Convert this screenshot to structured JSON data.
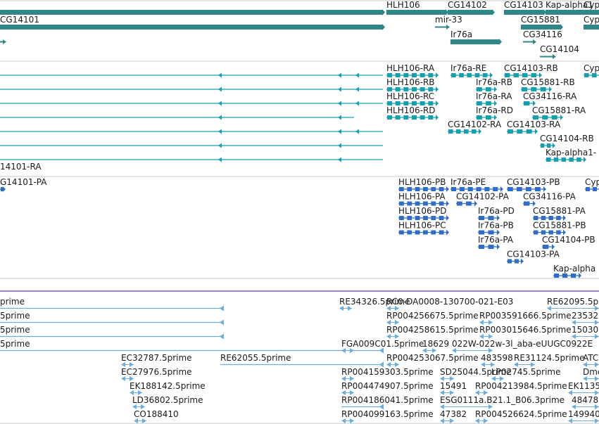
{
  "view": {
    "bp_start": 0,
    "bp_end": 851
  },
  "colors": {
    "gene": "#2f8787",
    "transcript": "#15a0b2",
    "protein": "#2f6dc8",
    "est": "#6aaee0",
    "divider": "#c8c8c8",
    "separator": "#7e57c2",
    "text": "#1a1a1a"
  },
  "tracks": {
    "genes": {
      "rows": [
        {
          "features": [
            {
              "name": "",
              "start": 0,
              "end": 544,
              "type": "bar"
            },
            {
              "name": "HLH106",
              "start": 549,
              "end": 634,
              "type": "bar"
            },
            {
              "name": "CG14102",
              "start": 636,
              "end": 700,
              "type": "bar"
            },
            {
              "name": "CG14103",
              "start": 716,
              "end": 773,
              "type": "bar"
            },
            {
              "name": "Kap-alpha1",
              "start": 775,
              "end": 829,
              "type": "bar"
            },
            {
              "name": "Cyp",
              "start": 829,
              "end": 851,
              "type": "bar"
            }
          ]
        },
        {
          "features": [
            {
              "name": "CG14101",
              "start": 0,
              "end": 544,
              "type": "bar"
            },
            {
              "name": "mir-33",
              "start": 618,
              "end": 634,
              "type": "arrow"
            },
            {
              "name": "CG15881",
              "start": 740,
              "end": 797,
              "type": "bar"
            },
            {
              "name": "Cyp",
              "start": 829,
              "end": 851,
              "type": "bar"
            }
          ]
        },
        {
          "features": [
            {
              "name": "",
              "start": 0,
              "end": 4,
              "type": "arrow"
            },
            {
              "name": "Ir76a",
              "start": 640,
              "end": 710,
              "type": "bar"
            },
            {
              "name": "CG34116",
              "start": 743,
              "end": 757,
              "type": "arrow"
            }
          ]
        },
        {
          "features": [
            {
              "name": "CG14104",
              "start": 767,
              "end": 785,
              "type": "arrow"
            }
          ]
        }
      ]
    },
    "transcripts": {
      "rows": [
        {
          "features": [
            {
              "name": "",
              "start": 0,
              "end": 544,
              "type": "line",
              "marks": [
                315,
                485,
                510
              ]
            },
            {
              "name": "HLH106-RA",
              "start": 549,
              "end": 619,
              "type": "exons"
            },
            {
              "name": "Ir76a-RE",
              "start": 640,
              "end": 696,
              "type": "exons"
            },
            {
              "name": "CG14103-RB",
              "start": 716,
              "end": 766,
              "type": "exons"
            },
            {
              "name": "Cyp",
              "start": 829,
              "end": 851,
              "type": "exons"
            }
          ]
        },
        {
          "features": [
            {
              "name": "",
              "start": 0,
              "end": 544,
              "type": "line",
              "marks": [
                315,
                485,
                510
              ]
            },
            {
              "name": "HLH106-RB",
              "start": 549,
              "end": 619,
              "type": "exons"
            },
            {
              "name": "Ir76a-RB",
              "start": 676,
              "end": 702,
              "type": "exons"
            },
            {
              "name": "CG15881-RB",
              "start": 740,
              "end": 780,
              "type": "exons"
            }
          ]
        },
        {
          "features": [
            {
              "name": "",
              "start": 0,
              "end": 544,
              "type": "line",
              "marks": [
                315,
                485,
                510
              ]
            },
            {
              "name": "HLH106-RC",
              "start": 549,
              "end": 619,
              "type": "exons"
            },
            {
              "name": "Ir76a-RA",
              "start": 676,
              "end": 702,
              "type": "exons"
            },
            {
              "name": "CG34116-RA",
              "start": 743,
              "end": 757,
              "type": "exons"
            }
          ]
        },
        {
          "features": [
            {
              "name": "",
              "start": 0,
              "end": 503,
              "type": "line",
              "marks": [
                315,
                485
              ]
            },
            {
              "name": "HLH106-RD",
              "start": 549,
              "end": 619,
              "type": "exons"
            },
            {
              "name": "Ir76a-RD",
              "start": 676,
              "end": 702,
              "type": "exons"
            },
            {
              "name": "CG15881-RA",
              "start": 756,
              "end": 796,
              "type": "exons"
            }
          ]
        },
        {
          "features": [
            {
              "name": "",
              "start": 0,
              "end": 544,
              "type": "line",
              "marks": [
                315,
                485,
                510
              ]
            },
            {
              "name": "CG14102-RA",
              "start": 636,
              "end": 680,
              "type": "exons"
            },
            {
              "name": "CG14103-RA",
              "start": 720,
              "end": 760,
              "type": "exons"
            }
          ]
        },
        {
          "features": [
            {
              "name": "",
              "start": 0,
              "end": 544,
              "type": "line",
              "marks": [
                315,
                485
              ]
            },
            {
              "name": "CG14104-RB",
              "start": 767,
              "end": 785,
              "type": "exons"
            }
          ]
        },
        {
          "features": [
            {
              "name": "",
              "start": 0,
              "end": 544,
              "type": "line",
              "marks": [
                315,
                485
              ]
            },
            {
              "name": "Kap-alpha1-",
              "start": 775,
              "end": 829,
              "type": "exons"
            }
          ]
        },
        {
          "features": [
            {
              "name": "14101-RA",
              "start": 0,
              "end": 0,
              "type": "label"
            }
          ]
        }
      ]
    },
    "proteins": {
      "rows": [
        {
          "features": [
            {
              "name": "G14101-PA",
              "start": 0,
              "end": 4,
              "type": "exons"
            },
            {
              "name": "HLH106-PB",
              "start": 566,
              "end": 634,
              "type": "exons"
            },
            {
              "name": "Ir76a-PE",
              "start": 640,
              "end": 711,
              "type": "exons"
            },
            {
              "name": "CG14103-PB",
              "start": 720,
              "end": 772,
              "type": "exons"
            },
            {
              "name": "Cyp",
              "start": 831,
              "end": 851,
              "type": "exons"
            }
          ]
        },
        {
          "features": [
            {
              "name": "HLH106-PA",
              "start": 566,
              "end": 634,
              "type": "exons"
            },
            {
              "name": "CG14102-PA",
              "start": 648,
              "end": 674,
              "type": "exons"
            },
            {
              "name": "CG34116-PA",
              "start": 743,
              "end": 757,
              "type": "exons"
            }
          ]
        },
        {
          "features": [
            {
              "name": "HLH106-PD",
              "start": 566,
              "end": 634,
              "type": "exons"
            },
            {
              "name": "Ir76a-PD",
              "start": 679,
              "end": 706,
              "type": "exons"
            },
            {
              "name": "CG15881-PA",
              "start": 757,
              "end": 800,
              "type": "exons"
            }
          ]
        },
        {
          "features": [
            {
              "name": "HLH106-PC",
              "start": 566,
              "end": 634,
              "type": "exons"
            },
            {
              "name": "Ir76a-PB",
              "start": 679,
              "end": 706,
              "type": "exons"
            },
            {
              "name": "CG15881-PB",
              "start": 757,
              "end": 800,
              "type": "exons"
            }
          ]
        },
        {
          "features": [
            {
              "name": "Ir76a-PA",
              "start": 679,
              "end": 706,
              "type": "exons"
            },
            {
              "name": "CG14104-PB",
              "start": 770,
              "end": 784,
              "type": "exons"
            }
          ]
        },
        {
          "features": [
            {
              "name": "CG14103-PA",
              "start": 720,
              "end": 740,
              "type": "exons"
            }
          ]
        },
        {
          "features": [
            {
              "name": "Kap-alpha",
              "start": 786,
              "end": 822,
              "type": "exons"
            }
          ]
        }
      ]
    },
    "ests": {
      "rows": [
        {
          "features": [
            {
              "name": "prime",
              "start": 0,
              "end": 318,
              "type": "line"
            },
            {
              "name": "RE34326.5prime",
              "start": 482,
              "end": 500,
              "type": "ticks"
            },
            {
              "name": "RC0-DA0008-130700-021-E03",
              "start": 549,
              "end": 567,
              "type": "ticks"
            },
            {
              "name": "RE62095.5p",
              "start": 777,
              "end": 851,
              "type": "ticks"
            }
          ]
        },
        {
          "features": [
            {
              "name": "5prime",
              "start": 0,
              "end": 318,
              "type": "line"
            },
            {
              "name": "RP004256675.5prime",
              "start": 549,
              "end": 567,
              "type": "ticks"
            },
            {
              "name": "RP003591666.5prime",
              "start": 681,
              "end": 700,
              "type": "ticks"
            },
            {
              "name": "23532",
              "start": 812,
              "end": 851,
              "type": "ticks"
            }
          ]
        },
        {
          "features": [
            {
              "name": "5prime",
              "start": 0,
              "end": 318,
              "type": "line"
            },
            {
              "name": "RP004258615.5prime",
              "start": 549,
              "end": 567,
              "type": "ticks"
            },
            {
              "name": "RP003015646.5prime",
              "start": 681,
              "end": 700,
              "type": "ticks"
            },
            {
              "name": "15030",
              "start": 812,
              "end": 851,
              "type": "ticks"
            }
          ]
        },
        {
          "features": [
            {
              "name": "5prime",
              "start": 0,
              "end": 545,
              "type": "line"
            },
            {
              "name": "FGA009C01.5prime",
              "start": 485,
              "end": 503,
              "type": "ticks"
            },
            {
              "name": "18629",
              "start": 600,
              "end": 620,
              "type": "ticks"
            },
            {
              "name": "022W-022w-3l_aba-eUUGC0922E",
              "start": 642,
              "end": 700,
              "type": "ticks"
            }
          ]
        },
        {
          "features": [
            {
              "name": "EC32787.5prime",
              "start": 172,
              "end": 190,
              "type": "ticks"
            },
            {
              "name": "RE62055.5prime",
              "start": 313,
              "end": 545,
              "type": "line"
            },
            {
              "name": "RP004253067.5prime",
              "start": 549,
              "end": 567,
              "type": "ticks"
            },
            {
              "name": "483598",
              "start": 683,
              "end": 703,
              "type": "ticks"
            },
            {
              "name": "RE31124.5prime",
              "start": 730,
              "end": 760,
              "type": "ticks"
            },
            {
              "name": "ATC",
              "start": 828,
              "end": 851,
              "type": "ticks"
            }
          ]
        },
        {
          "features": [
            {
              "name": "EC27976.5prime",
              "start": 172,
              "end": 190,
              "type": "ticks"
            },
            {
              "name": "RP004159303.5prime",
              "start": 485,
              "end": 503,
              "type": "ticks"
            },
            {
              "name": "SD25044.5prime",
              "start": 625,
              "end": 645,
              "type": "ticks"
            },
            {
              "name": "LP02745.5prime",
              "start": 698,
              "end": 716,
              "type": "ticks"
            },
            {
              "name": "Dme",
              "start": 828,
              "end": 851,
              "type": "ticks"
            }
          ]
        },
        {
          "features": [
            {
              "name": "EK188142.5prime",
              "start": 184,
              "end": 202,
              "type": "ticks"
            },
            {
              "name": "RP004474907.5prime",
              "start": 485,
              "end": 503,
              "type": "ticks"
            },
            {
              "name": "15491",
              "start": 625,
              "end": 645,
              "type": "ticks"
            },
            {
              "name": "RP004213984.5prime",
              "start": 675,
              "end": 693,
              "type": "ticks"
            },
            {
              "name": "EK1135",
              "start": 807,
              "end": 851,
              "type": "ticks"
            }
          ]
        },
        {
          "features": [
            {
              "name": "LD36802.5prime",
              "start": 188,
              "end": 206,
              "type": "ticks"
            },
            {
              "name": "RP004186041.5prime",
              "start": 485,
              "end": 545,
              "type": "line"
            },
            {
              "name": "ESG0111a.B21.1_B06.3prime",
              "start": 625,
              "end": 700,
              "type": "ticks"
            },
            {
              "name": "484780",
              "start": 812,
              "end": 851,
              "type": "ticks"
            }
          ]
        },
        {
          "features": [
            {
              "name": "CO188410",
              "start": 190,
              "end": 208,
              "type": "ticks"
            },
            {
              "name": "RP004099163.5prime",
              "start": 485,
              "end": 503,
              "type": "ticks"
            },
            {
              "name": "47382",
              "start": 625,
              "end": 645,
              "type": "ticks"
            },
            {
              "name": "RP004526624.5prime",
              "start": 675,
              "end": 693,
              "type": "ticks"
            },
            {
              "name": "149940",
              "start": 807,
              "end": 851,
              "type": "ticks"
            }
          ]
        }
      ]
    }
  }
}
